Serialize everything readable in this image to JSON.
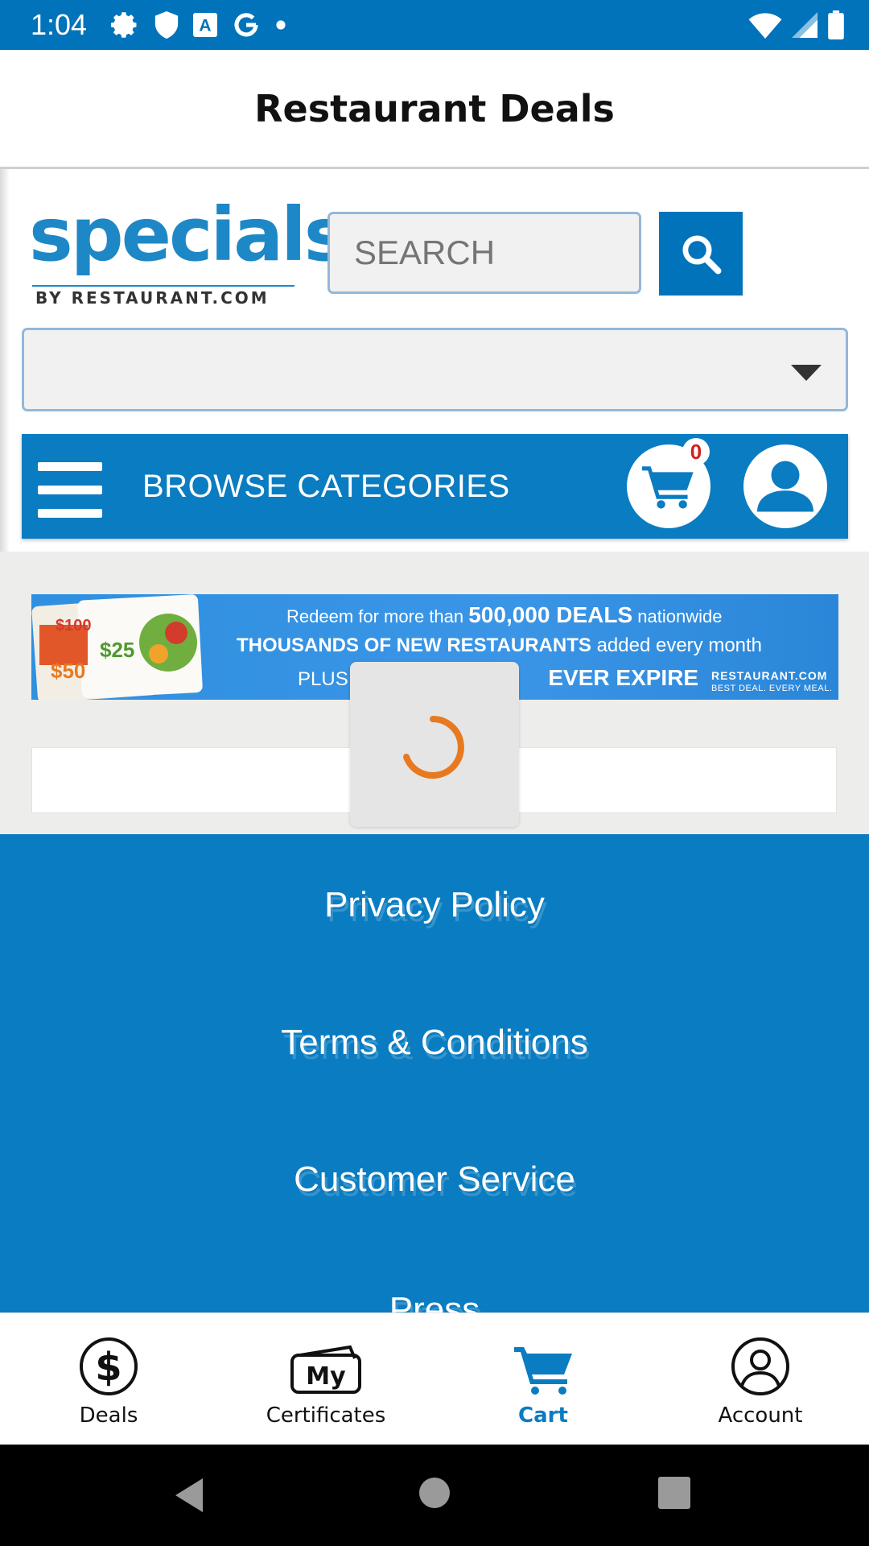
{
  "status_bar": {
    "time": "1:04",
    "left_icons": [
      "gear-icon",
      "shield-icon",
      "text-a-icon",
      "google-g-icon",
      "dot-icon"
    ],
    "right_icons": [
      "wifi-icon",
      "signal-icon",
      "battery-icon"
    ]
  },
  "app_bar": {
    "title": "Restaurant Deals"
  },
  "header": {
    "logo_text": "specials",
    "logo_subtext": "BY RESTAURANT.COM",
    "search_placeholder": "SEARCH",
    "search_icon": "search-icon"
  },
  "location_select": {
    "selected": ""
  },
  "category_bar": {
    "label": "BROWSE CATEGORIES",
    "cart_count": "0"
  },
  "banner": {
    "line1_pre": "Redeem for more than",
    "line1_bold": "500,000 DEALS",
    "line1_post": "nationwide",
    "line2_bold": "THOUSANDS OF NEW RESTAURANTS",
    "line2_post": "added every month",
    "line3_pre": "PLUS c",
    "line3_bold": "EVER EXPIRE",
    "brand": "RESTAURANT.COM",
    "brand_tag": "BEST DEAL. EVERY MEAL.",
    "card_values": [
      "$100",
      "$25",
      "$50"
    ]
  },
  "footer": {
    "links": [
      "Privacy Policy",
      "Terms & Conditions",
      "Customer Service",
      "Press"
    ]
  },
  "bottom_nav": {
    "tabs": [
      {
        "label": "Deals",
        "icon": "dollar-icon"
      },
      {
        "label": "Certificates",
        "icon": "certificates-icon"
      },
      {
        "label": "Cart",
        "icon": "cart-icon",
        "active": true
      },
      {
        "label": "Account",
        "icon": "account-icon"
      }
    ]
  },
  "colors": {
    "primary": "#0a7cc1",
    "status_bar": "#0073bb",
    "spinner": "#e8791f",
    "badge": "#d41f1f"
  }
}
